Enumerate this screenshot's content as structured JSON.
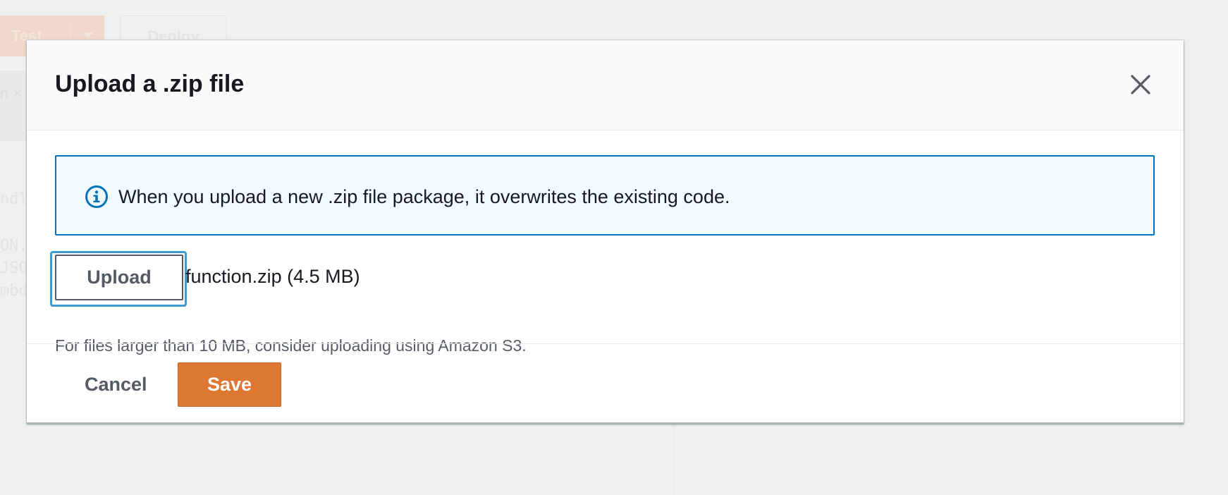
{
  "background": {
    "test_label": "Test",
    "deploy_label": "Deploy",
    "tab_fragment": "n ×",
    "code_lines": [
      "ndl",
      "ON.",
      "JSO",
      "mbd"
    ]
  },
  "modal": {
    "title": "Upload a .zip file",
    "close_icon": "close-icon",
    "info_icon": "info-icon",
    "info_message": "When you upload a new .zip file package, it overwrites the existing code.",
    "upload_label": "Upload",
    "file_name": "function.zip (4.5 MB)",
    "hint": "For files larger than 10 MB, consider uploading using Amazon S3.",
    "cancel_label": "Cancel",
    "save_label": "Save"
  },
  "colors": {
    "primary_button": "#dd7833",
    "info_border": "#0073bb",
    "info_background": "#f1faff",
    "focus_ring": "#3d9bd1",
    "text": "#16191f",
    "secondary_text": "#545b64"
  }
}
